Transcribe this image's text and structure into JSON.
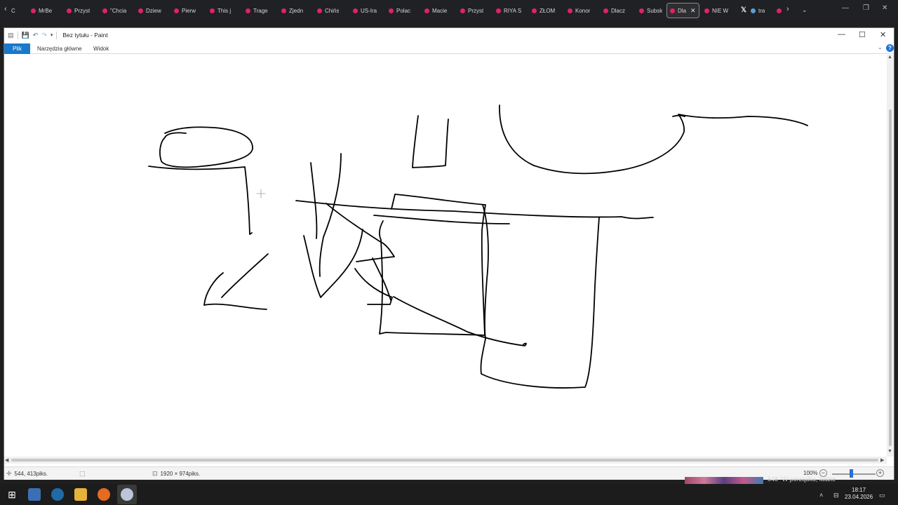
{
  "browser": {
    "tabs": [
      {
        "label": "C",
        "icon": "back-icon"
      },
      {
        "label": "MrBe",
        "icon": "youtube-icon"
      },
      {
        "label": "Przyst",
        "icon": "youtube-icon"
      },
      {
        "label": "\"Chcia",
        "icon": "youtube-icon"
      },
      {
        "label": "Dziew",
        "icon": "youtube-icon"
      },
      {
        "label": "Pierw",
        "icon": "youtube-icon"
      },
      {
        "label": "This j",
        "icon": "youtube-icon"
      },
      {
        "label": "Trage",
        "icon": "youtube-icon"
      },
      {
        "label": "Zjedn",
        "icon": "youtube-icon"
      },
      {
        "label": "Chińs",
        "icon": "youtube-icon"
      },
      {
        "label": "US-Ira",
        "icon": "youtube-icon"
      },
      {
        "label": "Polac",
        "icon": "youtube-icon"
      },
      {
        "label": "Macie",
        "icon": "youtube-icon"
      },
      {
        "label": "Przyst",
        "icon": "youtube-icon"
      },
      {
        "label": "RIYA S",
        "icon": "youtube-icon"
      },
      {
        "label": "ZŁOM",
        "icon": "youtube-icon"
      },
      {
        "label": "Konor",
        "icon": "youtube-icon"
      },
      {
        "label": "Dlacz",
        "icon": "youtube-icon"
      },
      {
        "label": "Subsk",
        "icon": "youtube-icon"
      },
      {
        "label": "Dla",
        "icon": "youtube-icon",
        "active": true
      },
      {
        "label": "NIE W",
        "icon": "youtube-icon"
      },
      {
        "label": "tra",
        "icon": "x-icon"
      },
      {
        "label": "",
        "icon": "youtube-icon"
      }
    ]
  },
  "paint": {
    "window_title": "Bez tytułu - Paint",
    "ribbon_tabs": {
      "file": "Plik",
      "home": "Narzędzia główne",
      "view": "Widok"
    },
    "status": {
      "cursor_pos": "544, 413piks.",
      "canvas_size": "1920 × 974piks.",
      "zoom": "100%"
    },
    "stroke_color": "#000000"
  },
  "taskbar": {
    "notification_text": "548 \"W porządku, ludzie",
    "time": "18:17",
    "date": "23.04.2026"
  }
}
